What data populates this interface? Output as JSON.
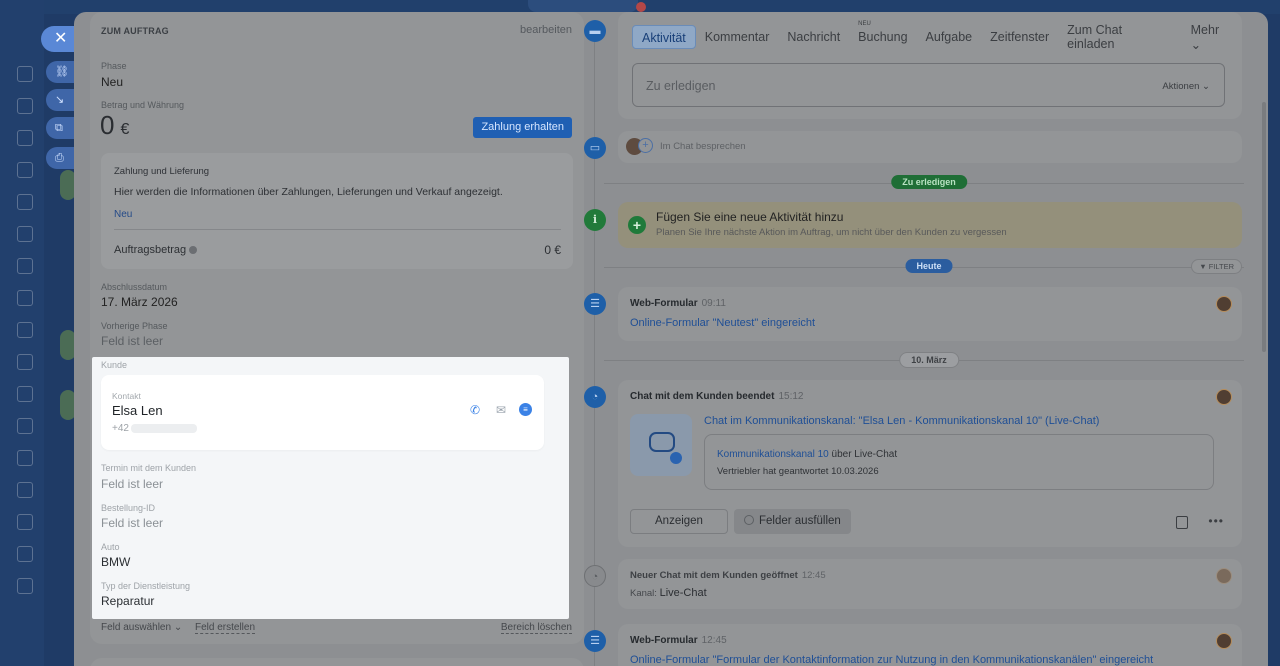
{
  "left": {
    "section_title": "ZUM AUFTRAG",
    "edit_label": "bearbeiten",
    "phase_label": "Phase",
    "phase_value": "Neu",
    "amount_label": "Betrag und Währung",
    "amount_value": "0",
    "amount_currency": "€",
    "pay_button": "Zahlung erhalten",
    "payment_box": {
      "title": "Zahlung und Lieferung",
      "description": "Hier werden die Informationen über Zahlungen, Lieferungen und Verkauf angezeigt.",
      "status": "Neu",
      "order_amount_label": "Auftragsbetrag",
      "order_amount_value": "0 €"
    },
    "close_date_label": "Abschlussdatum",
    "close_date_value": "17. März 2026",
    "prev_phase_label": "Vorherige Phase",
    "prev_phase_value": "Feld ist leer",
    "customer_label": "Kunde",
    "contact": {
      "label": "Kontakt",
      "name": "Elsa Len",
      "phone_prefix": "+42"
    },
    "appointment_label": "Termin mit dem Kunden",
    "appointment_value": "Feld ist leer",
    "order_id_label": "Bestellung-ID",
    "order_id_value": "Feld ist leer",
    "car_label": "Auto",
    "car_value": "BMW",
    "service_label": "Typ der Dienstleistung",
    "service_value": "Reparatur",
    "select_field": "Feld auswählen ⌄",
    "create_field": "Feld erstellen",
    "clear_section": "Bereich löschen"
  },
  "timeline": {
    "tabs": [
      {
        "label": "Aktivität",
        "active": true
      },
      {
        "label": "Kommentar"
      },
      {
        "label": "Nachricht"
      },
      {
        "label": "Buchung",
        "badge": "NEU"
      },
      {
        "label": "Aufgabe"
      },
      {
        "label": "Zeitfenster"
      },
      {
        "label": "Zum Chat einladen"
      },
      {
        "label": "Mehr ⌄"
      }
    ],
    "todo_placeholder": "Zu erledigen",
    "actions_label": "Aktionen ⌄",
    "chat_placeholder": "Im Chat besprechen",
    "divider_todo": "Zu erledigen",
    "add_activity_title": "Fügen Sie eine neue Aktivität hinzu",
    "add_activity_sub": "Planen Sie Ihre nächste Aktion im Auftrag, um nicht über den Kunden zu vergessen",
    "divider_today": "Heute",
    "filter_label": "▼ FILTER",
    "item1": {
      "title": "Web-Formular",
      "time": "09:11",
      "link": "Online-Formular \"Neutest\" eingereicht"
    },
    "divider_date": "10. März",
    "item2": {
      "title": "Chat mit dem Kunden beendet",
      "time": "15:12",
      "link": "Chat im Kommunikationskanal: \"Elsa Len - Kommunikationskanal 10\" (Live-Chat)",
      "channel_link": "Kommunikationskanal 10",
      "channel_rest": " über Live-Chat",
      "answered": "Vertriebler hat geantwortet 10.03.2026",
      "show_button": "Anzeigen",
      "fill_button": "Felder ausfüllen"
    },
    "item3": {
      "title": "Neuer Chat mit dem Kunden geöffnet",
      "time": "12:45",
      "channel_label": "Kanal:",
      "channel_value": "Live-Chat"
    },
    "item4": {
      "title": "Web-Formular",
      "time": "12:45",
      "link": "Online-Formular \"Formular der Kontaktinformation zur Nutzung in den Kommunikationskanälen\" eingereicht"
    }
  }
}
